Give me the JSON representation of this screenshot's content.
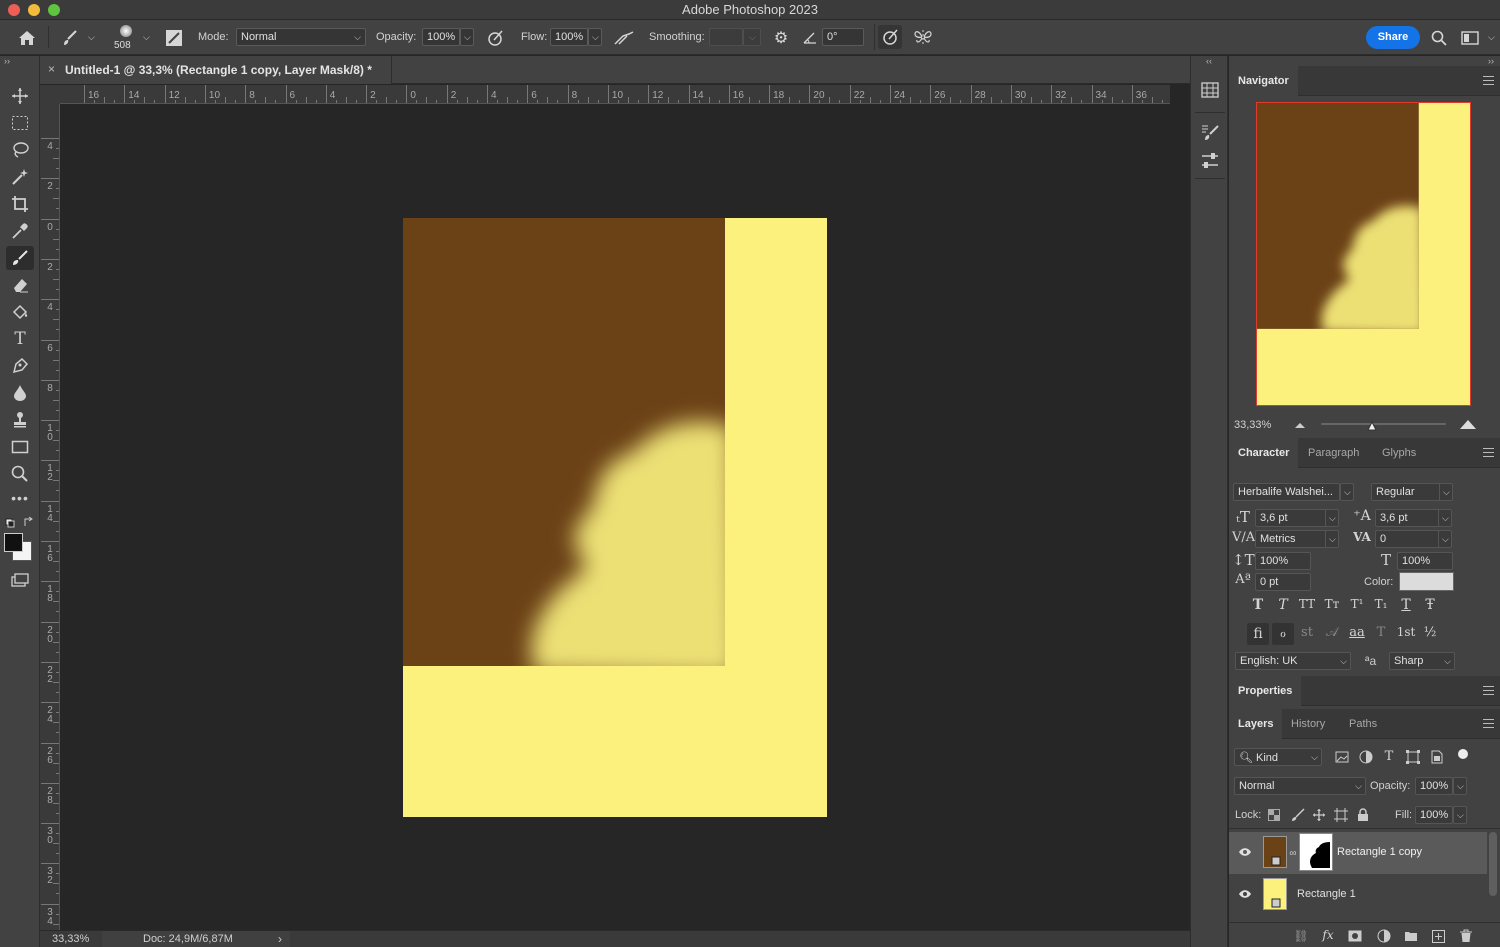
{
  "app": {
    "title": "Adobe Photoshop 2023"
  },
  "options": {
    "brush_size": "508",
    "mode_label": "Mode:",
    "mode_value": "Normal",
    "opacity_label": "Opacity:",
    "opacity_value": "100%",
    "flow_label": "Flow:",
    "flow_value": "100%",
    "smoothing_label": "Smoothing:",
    "smoothing_value": "",
    "angle_value": "0°",
    "share_label": "Share"
  },
  "document": {
    "tab_title": "Untitled-1 @ 33,3% (Rectangle 1 copy, Layer Mask/8) *",
    "close_glyph": "×"
  },
  "ruler": {
    "top_labels": [
      "16",
      "14",
      "12",
      "10",
      "8",
      "6",
      "4",
      "2",
      "0",
      "2",
      "4",
      "6",
      "8",
      "10",
      "12",
      "14",
      "16",
      "18",
      "20",
      "22",
      "24",
      "26",
      "28",
      "30",
      "32",
      "34",
      "36"
    ],
    "left_labels": [
      "4",
      "2",
      "0",
      "2",
      "4",
      "6",
      "8",
      "10",
      "12",
      "14",
      "16",
      "18",
      "20",
      "22",
      "24",
      "26",
      "28",
      "30",
      "32",
      "34"
    ]
  },
  "canvas": {
    "dark_color": "#6b4116",
    "light_color": "#fdf17e",
    "blob_color": "#ece075"
  },
  "statusbar": {
    "zoom": "33,33%",
    "doc": "Doc: 24,9M/6,87M",
    "arrow": "›"
  },
  "navigator": {
    "title": "Navigator",
    "zoom": "33,33%"
  },
  "character": {
    "tabs": [
      "Character",
      "Paragraph",
      "Glyphs"
    ],
    "font_family": "Herbalife Walshei...",
    "font_style": "Regular",
    "size": "3,6 pt",
    "leading": "3,6 pt",
    "kerning": "Metrics",
    "tracking": "0",
    "vscale": "100%",
    "hscale": "100%",
    "baseline": "0 pt",
    "color_label": "Color:",
    "language": "English: UK",
    "antialias_icon": "ªa",
    "antialias": "Sharp",
    "style_glyphs": [
      "T",
      "T",
      "TT",
      "Tт",
      "T¹",
      "T₁",
      "T",
      "Ŧ"
    ],
    "ot_glyphs": [
      "ﬁ",
      "ℴ",
      "st",
      "𝒜",
      "aa",
      "T",
      "1st",
      "½"
    ]
  },
  "properties": {
    "title": "Properties"
  },
  "layers": {
    "tabs": [
      "Layers",
      "History",
      "Paths"
    ],
    "filter_kind": "Kind",
    "blend_mode": "Normal",
    "opacity_label": "Opacity:",
    "opacity_value": "100%",
    "lock_label": "Lock:",
    "fill_label": "Fill:",
    "fill_value": "100%",
    "items": [
      {
        "name": "Rectangle 1 copy"
      },
      {
        "name": "Rectangle 1"
      }
    ]
  },
  "toolbar_icons": [
    "move-icon",
    "marquee-icon",
    "lasso-icon",
    "magic-wand-icon",
    "crop-icon",
    "eyedropper-icon",
    "brush-icon",
    "eraser-icon",
    "paint-bucket-icon",
    "type-icon",
    "pen-icon",
    "blur-icon",
    "stamp-icon",
    "rectangle-icon",
    "zoom-icon",
    "more-icon"
  ]
}
